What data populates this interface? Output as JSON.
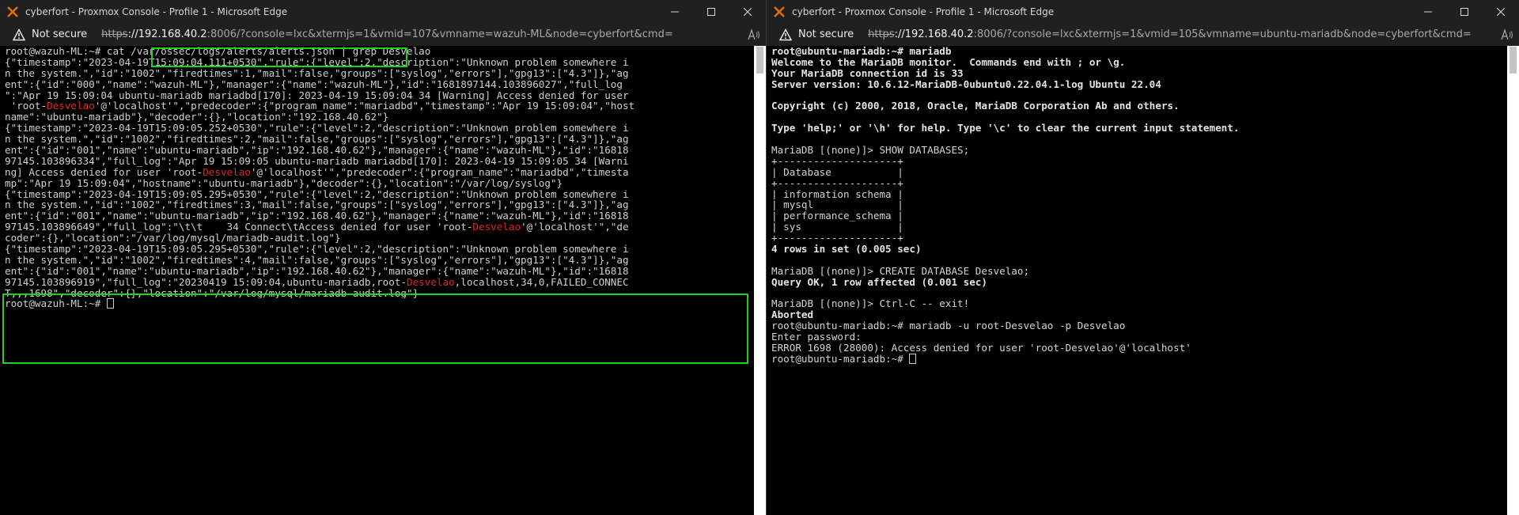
{
  "left_window": {
    "title": "cyberfort - Proxmox Console - Profile 1 - Microsoft Edge",
    "security_label": "Not secure",
    "url_proto": "https",
    "url_host": "://192.168.40.2",
    "url_rest": ":8006/?console=lxc&xtermjs=1&vmid=107&vmname=wazuh-ML&node=cyberfort&cmd=",
    "terminal_lines": [
      [
        {
          "t": "root@wazuh-ML:~# cat /var/ossec/logs/alerts/alerts.json | grep Desvelao"
        }
      ],
      [
        {
          "t": "{\"timestamp\":\"2023-04-19T15:09:04.111+0530\",\"rule\":{\"level\":2,\"description\":\"Unknown problem somewhere i"
        }
      ],
      [
        {
          "t": "n the system.\",\"id\":\"1002\",\"firedtimes\":1,\"mail\":false,\"groups\":[\"syslog\",\"errors\"],\"gpg13\":[\"4.3\"]},\"ag"
        }
      ],
      [
        {
          "t": "ent\":{\"id\":\"000\",\"name\":\"wazuh-ML\"},\"manager\":{\"name\":\"wazuh-ML\"},\"id\":\"1681897144.103896027\",\"full_log"
        }
      ],
      [
        {
          "t": "\":\"Apr 19 15:09:04 ubuntu-mariadb mariadbd[170]: 2023-04-19 15:09:04 34 [Warning] Access denied for user"
        }
      ],
      [
        {
          "t": " 'root-"
        },
        {
          "t": "Desvelao",
          "h": true
        },
        {
          "t": "'@'localhost'\",\"predecoder\":{\"program_name\":\"mariadbd\",\"timestamp\":\"Apr 19 15:09:04\",\"host"
        }
      ],
      [
        {
          "t": "name\":\"ubuntu-mariadb\"},\"decoder\":{},\"location\":\"192.168.40.62\"}"
        }
      ],
      [
        {
          "t": "{\"timestamp\":\"2023-04-19T15:09:05.252+0530\",\"rule\":{\"level\":2,\"description\":\"Unknown problem somewhere i"
        }
      ],
      [
        {
          "t": "n the system.\",\"id\":\"1002\",\"firedtimes\":2,\"mail\":false,\"groups\":[\"syslog\",\"errors\"],\"gpg13\":[\"4.3\"]},\"ag"
        }
      ],
      [
        {
          "t": "ent\":{\"id\":\"001\",\"name\":\"ubuntu-mariadb\",\"ip\":\"192.168.40.62\"},\"manager\":{\"name\":\"wazuh-ML\"},\"id\":\"16818"
        }
      ],
      [
        {
          "t": "97145.103896334\",\"full_log\":\"Apr 19 15:09:05 ubuntu-mariadb mariadbd[170]: 2023-04-19 15:09:05 34 [Warni"
        }
      ],
      [
        {
          "t": "ng] Access denied for user 'root-"
        },
        {
          "t": "Desvelao",
          "h": true
        },
        {
          "t": "'@'localhost'\",\"predecoder\":{\"program_name\":\"mariadbd\",\"timesta"
        }
      ],
      [
        {
          "t": "mp\":\"Apr 19 15:09:04\",\"hostname\":\"ubuntu-mariadb\"},\"decoder\":{},\"location\":\"/var/log/syslog\"}"
        }
      ],
      [
        {
          "t": "{\"timestamp\":\"2023-04-19T15:09:05.295+0530\",\"rule\":{\"level\":2,\"description\":\"Unknown problem somewhere i"
        }
      ],
      [
        {
          "t": "n the system.\",\"id\":\"1002\",\"firedtimes\":3,\"mail\":false,\"groups\":[\"syslog\",\"errors\"],\"gpg13\":[\"4.3\"]},\"ag"
        }
      ],
      [
        {
          "t": "ent\":{\"id\":\"001\",\"name\":\"ubuntu-mariadb\",\"ip\":\"192.168.40.62\"},\"manager\":{\"name\":\"wazuh-ML\"},\"id\":\"16818"
        }
      ],
      [
        {
          "t": "97145.103896649\",\"full_log\":\"\\t\\t    34 Connect\\tAccess denied for user 'root-"
        },
        {
          "t": "Desvelao",
          "h": true
        },
        {
          "t": "'@'localhost'\",\"de"
        }
      ],
      [
        {
          "t": "coder\":{},\"location\":\"/var/log/mysql/mariadb-audit.log\"}"
        }
      ],
      [
        {
          "t": "{\"timestamp\":\"2023-04-19T15:09:05.295+0530\",\"rule\":{\"level\":2,\"description\":\"Unknown problem somewhere i"
        }
      ],
      [
        {
          "t": "n the system.\",\"id\":\"1002\",\"firedtimes\":4,\"mail\":false,\"groups\":[\"syslog\",\"errors\"],\"gpg13\":[\"4.3\"]},\"ag"
        }
      ],
      [
        {
          "t": "ent\":{\"id\":\"001\",\"name\":\"ubuntu-mariadb\",\"ip\":\"192.168.40.62\"},\"manager\":{\"name\":\"wazuh-ML\"},\"id\":\"16818"
        }
      ],
      [
        {
          "t": "97145.103896919\",\"full_log\":\"20230419 15:09:04,ubuntu-mariadb,root-"
        },
        {
          "t": "Desvelao",
          "h": true
        },
        {
          "t": ",localhost,34,0,FAILED_CONNEC"
        }
      ],
      [
        {
          "t": "T,,,1698\",\"decoder\":{},\"location\":\"/var/log/mysql/mariadb-audit.log\"}"
        }
      ],
      [
        {
          "t": "root@wazuh-ML:~# "
        },
        {
          "cursor": true
        }
      ]
    ]
  },
  "right_window": {
    "title": "cyberfort - Proxmox Console - Profile 1 - Microsoft Edge",
    "security_label": "Not secure",
    "url_proto": "https",
    "url_host": "://192.168.40.2",
    "url_rest": ":8006/?console=lxc&xtermjs=1&vmid=105&vmname=ubuntu-mariadb&node=cyberfort&cmd=",
    "terminal_lines": [
      [
        {
          "t": "root@ubuntu-mariadb:~# mariadb"
        }
      ],
      [
        {
          "t": "Welcome to the MariaDB monitor.  Commands end with ; or \\g."
        }
      ],
      [
        {
          "t": "Your MariaDB connection id is 33"
        }
      ],
      [
        {
          "t": "Server version: 10.6.12-MariaDB-0ubuntu0.22.04.1-log Ubuntu 22.04"
        }
      ],
      [
        {
          "t": ""
        }
      ],
      [
        {
          "t": "Copyright (c) 2000, 2018, Oracle, MariaDB Corporation Ab and others."
        }
      ],
      [
        {
          "t": ""
        }
      ],
      [
        {
          "t": "Type 'help;' or '\\h' for help. Type '\\c' to clear the current input statement."
        }
      ],
      [
        {
          "t": ""
        }
      ],
      [
        {
          "t": "MariaDB [(none)]> SHOW DATABASES;",
          "d": true
        }
      ],
      [
        {
          "t": "+--------------------+",
          "d": true
        }
      ],
      [
        {
          "t": "| Database           |",
          "d": true
        }
      ],
      [
        {
          "t": "+--------------------+",
          "d": true
        }
      ],
      [
        {
          "t": "| information_schema |",
          "d": true
        }
      ],
      [
        {
          "t": "| mysql              |",
          "d": true
        }
      ],
      [
        {
          "t": "| performance_schema |",
          "d": true
        }
      ],
      [
        {
          "t": "| sys                |",
          "d": true
        }
      ],
      [
        {
          "t": "+--------------------+",
          "d": true
        }
      ],
      [
        {
          "t": "4 rows in set (0.005 sec)"
        }
      ],
      [
        {
          "t": ""
        }
      ],
      [
        {
          "t": "MariaDB [(none)]> CREATE DATABASE Desvelao;",
          "d": true
        }
      ],
      [
        {
          "t": "Query OK, 1 row affected (0.001 sec)"
        }
      ],
      [
        {
          "t": ""
        }
      ],
      [
        {
          "t": "MariaDB [(none)]> Ctrl-C -- exit!",
          "d": true
        }
      ],
      [
        {
          "t": "Aborted"
        }
      ],
      [
        {
          "t": "root@ubuntu-mariadb:~# mariadb -u root-Desvelao -p Desvelao",
          "d": true
        }
      ],
      [
        {
          "t": "Enter password:",
          "d": true
        }
      ],
      [
        {
          "t": "ERROR 1698 (28000): Access denied for user 'root-Desvelao'@'localhost'",
          "d": true
        }
      ],
      [
        {
          "t": "root@ubuntu-mariadb:~# ",
          "d": true
        },
        {
          "cursor": true
        }
      ]
    ]
  },
  "colors": {
    "highlight_box": "#1ed21e",
    "keyword_red": "#e02525",
    "chrome_bg": "#202020",
    "terminal_bg": "#000000"
  }
}
